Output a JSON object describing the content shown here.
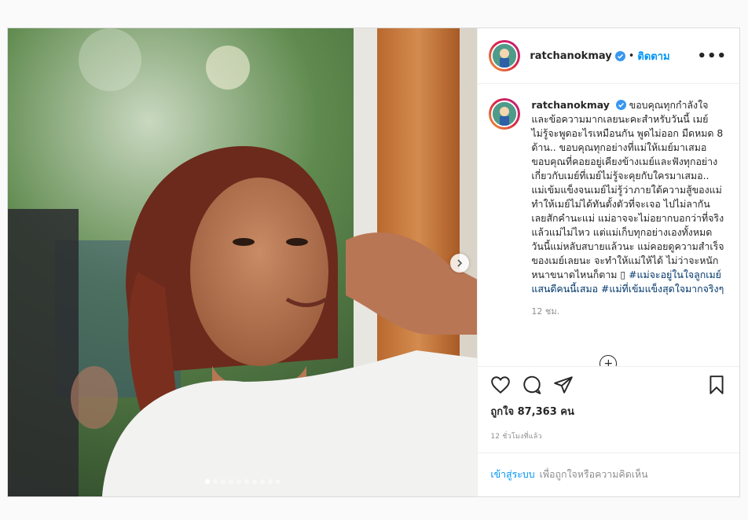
{
  "post": {
    "username": "ratchanokmay",
    "follow_label": "ติดตาม",
    "separator": "•",
    "more_label": "•••",
    "caption": "ขอบคุณทุกกำลังใจและข้อความมากเลยนะคะสำหรับวันนี้ เมย์ไม่รู้จะพูดอะไรเหมือนกัน พูดไม่ออก มืดหมด 8 ด้าน.. ขอบคุณทุกอย่างที่แม่ให้เมย์มาเสมอ ขอบคุณที่คอยอยู่เคียงข้างเมย์และฟังทุกอย่างเกี่ยวกับเมย์ที่เมย์ไม่รู้จะคุยกับใครมาเสมอ.. แม่เข้มแข็งจนเมย์ไม่รู้ว่าภายใต้ความสู้ของแม่ทำให้เมย์ไม่ได้ทันตั้งตัวที่จะเจอ ไปไม่ลากันเลยสักคำนะแม่ แม่อาจจะไม่อยากบอกว่าที่จริงแล้วแม่ไม่ไหว แต่แม่เก็บทุกอย่างเองทั้งหมด วันนี้แม่หลับสบายแล้วนะ แม่คอยดูความสำเร็จของเมย์เลยนะ จะทำให้แม่ให้ได้ ไม่ว่าจะหนักหนาขนาดไหนก็ตาม ▯ ",
    "hashtags": "#แม่จะอยู่ในใจลูกเมย์แสนดีคนนี้เสมอ #แม่ที่เข้มแข็งสุดใจมากจริงๆ",
    "caption_time": "12 ชม.",
    "likes_label": "ถูกใจ 87,363 คน",
    "posted_ago": "12 ชั่วโมงที่แล้ว",
    "login_link": "เข้าสู่ระบบ",
    "login_prompt": "เพื่อถูกใจหรือความคิดเห็น",
    "load_more_icon": "+"
  },
  "icons": {
    "like": "heart-icon",
    "comment": "comment-icon",
    "share": "paper-plane-icon",
    "save": "bookmark-icon",
    "next": "chevron-right-icon",
    "verified": "verified-badge-icon"
  },
  "carousel": {
    "count": 10,
    "active_index": 0
  },
  "colors": {
    "accent": "#0095f6",
    "verified": "#3897f0",
    "hashtag": "#00376b"
  }
}
